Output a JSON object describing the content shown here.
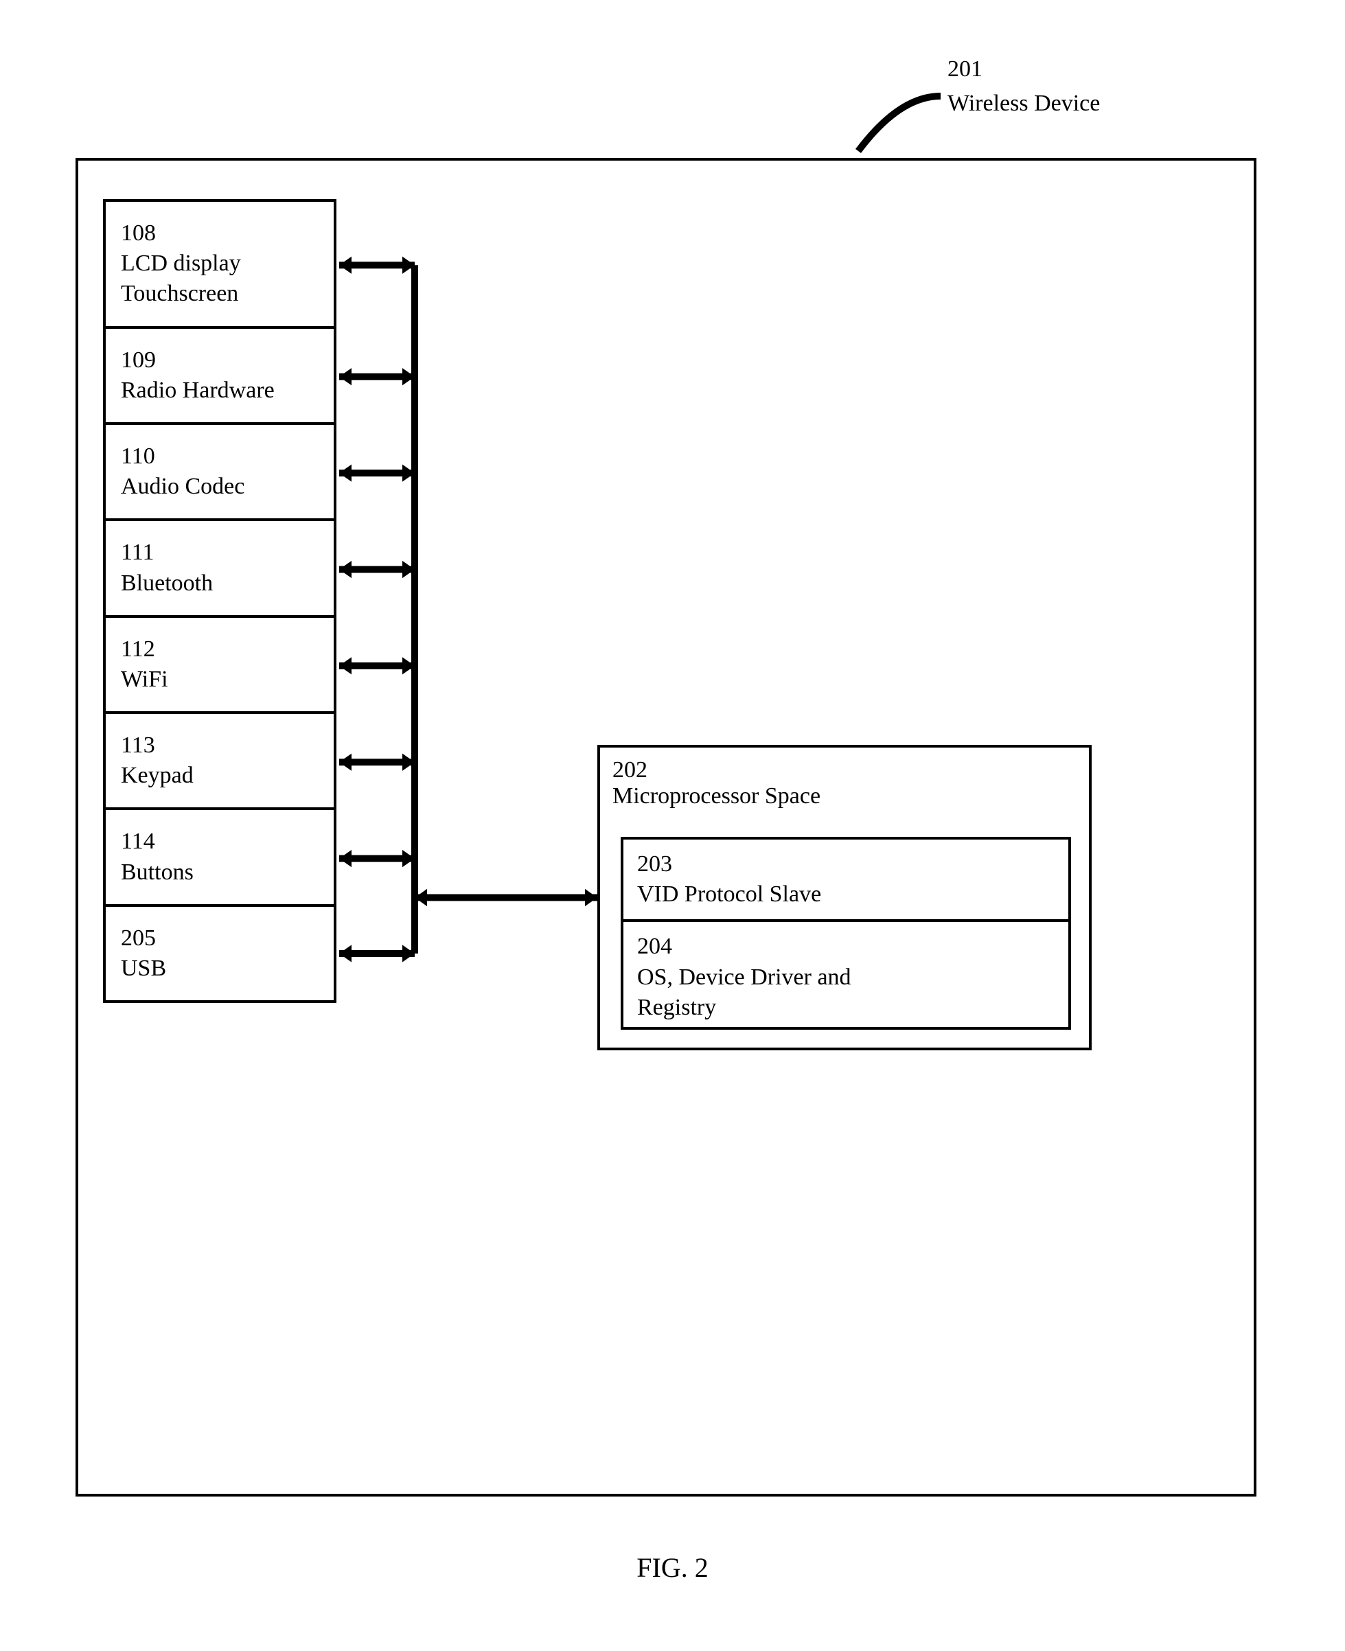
{
  "title_ref": "201",
  "title_text": "Wireless Device",
  "left_stack": [
    {
      "ref": "108",
      "label": "LCD display\nTouchscreen"
    },
    {
      "ref": "109",
      "label": "Radio Hardware"
    },
    {
      "ref": "110",
      "label": "Audio Codec"
    },
    {
      "ref": "111",
      "label": "Bluetooth"
    },
    {
      "ref": "112",
      "label": "WiFi"
    },
    {
      "ref": "113",
      "label": "Keypad"
    },
    {
      "ref": "114",
      "label": "Buttons"
    },
    {
      "ref": "205",
      "label": "USB"
    }
  ],
  "microprocessor": {
    "ref": "202",
    "label": "Microprocessor Space",
    "children": [
      {
        "ref": "203",
        "label": "VID Protocol Slave"
      },
      {
        "ref": "204",
        "label": "OS, Device Driver and\nRegistry"
      }
    ]
  },
  "figure_caption": "FIG. 2",
  "chart_data": {
    "type": "table",
    "description": "Patent-style block diagram of a wireless device (201). A left column of hardware component boxes is connected via a bidirectional bus to a Microprocessor Space (202) containing a VID Protocol Slave (203) and OS/Device Driver/Registry (204).",
    "container": {
      "ref": "201",
      "label": "Wireless Device"
    },
    "left_components": [
      {
        "ref": "108",
        "label": "LCD display Touchscreen"
      },
      {
        "ref": "109",
        "label": "Radio Hardware"
      },
      {
        "ref": "110",
        "label": "Audio Codec"
      },
      {
        "ref": "111",
        "label": "Bluetooth"
      },
      {
        "ref": "112",
        "label": "WiFi"
      },
      {
        "ref": "113",
        "label": "Keypad"
      },
      {
        "ref": "114",
        "label": "Buttons"
      },
      {
        "ref": "205",
        "label": "USB"
      }
    ],
    "right_block": {
      "ref": "202",
      "label": "Microprocessor Space",
      "contains": [
        {
          "ref": "203",
          "label": "VID Protocol Slave"
        },
        {
          "ref": "204",
          "label": "OS, Device Driver and Registry"
        }
      ]
    },
    "connections": "Each left component has a bidirectional arrow to a common vertical bus; the bus has a bidirectional arrow to the Microprocessor Space block."
  }
}
